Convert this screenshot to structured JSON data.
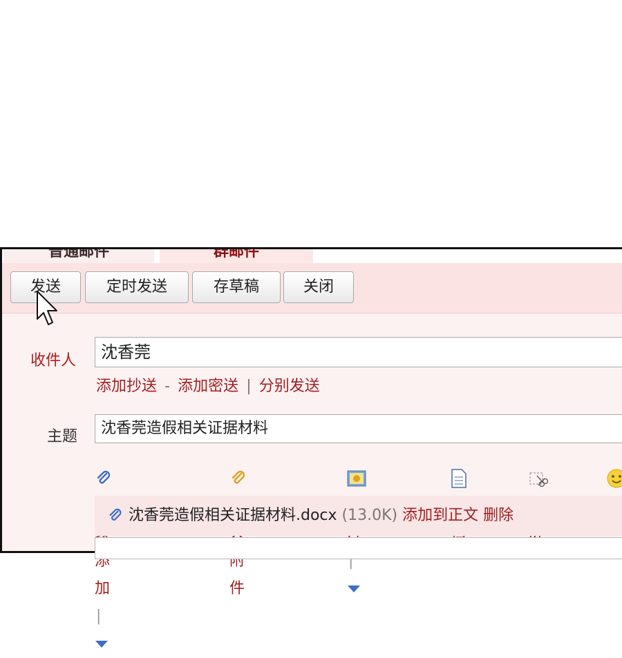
{
  "tabs": {
    "normal": "普通邮件",
    "group": "群邮件"
  },
  "toolbar": {
    "send": "发送",
    "scheduled_send": "定时发送",
    "save_draft": "存草稿",
    "close": "关闭"
  },
  "form": {
    "recipient_label": "收件人",
    "recipient_value": "沈香莞",
    "add_cc": "添加抄送",
    "dash": "-",
    "add_bcc": "添加密送",
    "divider": "|",
    "separate_send": "分别发送",
    "subject_label": "主题",
    "subject_value": "沈香莞造假相关证据材料"
  },
  "attachments": {
    "continue_add": "继续添加",
    "large_attachment": "超大附件",
    "photo": "照片",
    "document": "文档",
    "screenshot": "截屏"
  },
  "file": {
    "name": "沈香莞造假相关证据材料.docx",
    "size": "(13.0K)",
    "add_to_body": "添加到正文",
    "delete": "删除"
  },
  "colors": {
    "link": "#a32020",
    "toolbar_bg": "#fbe3e4",
    "form_bg": "#fdf2f2"
  }
}
